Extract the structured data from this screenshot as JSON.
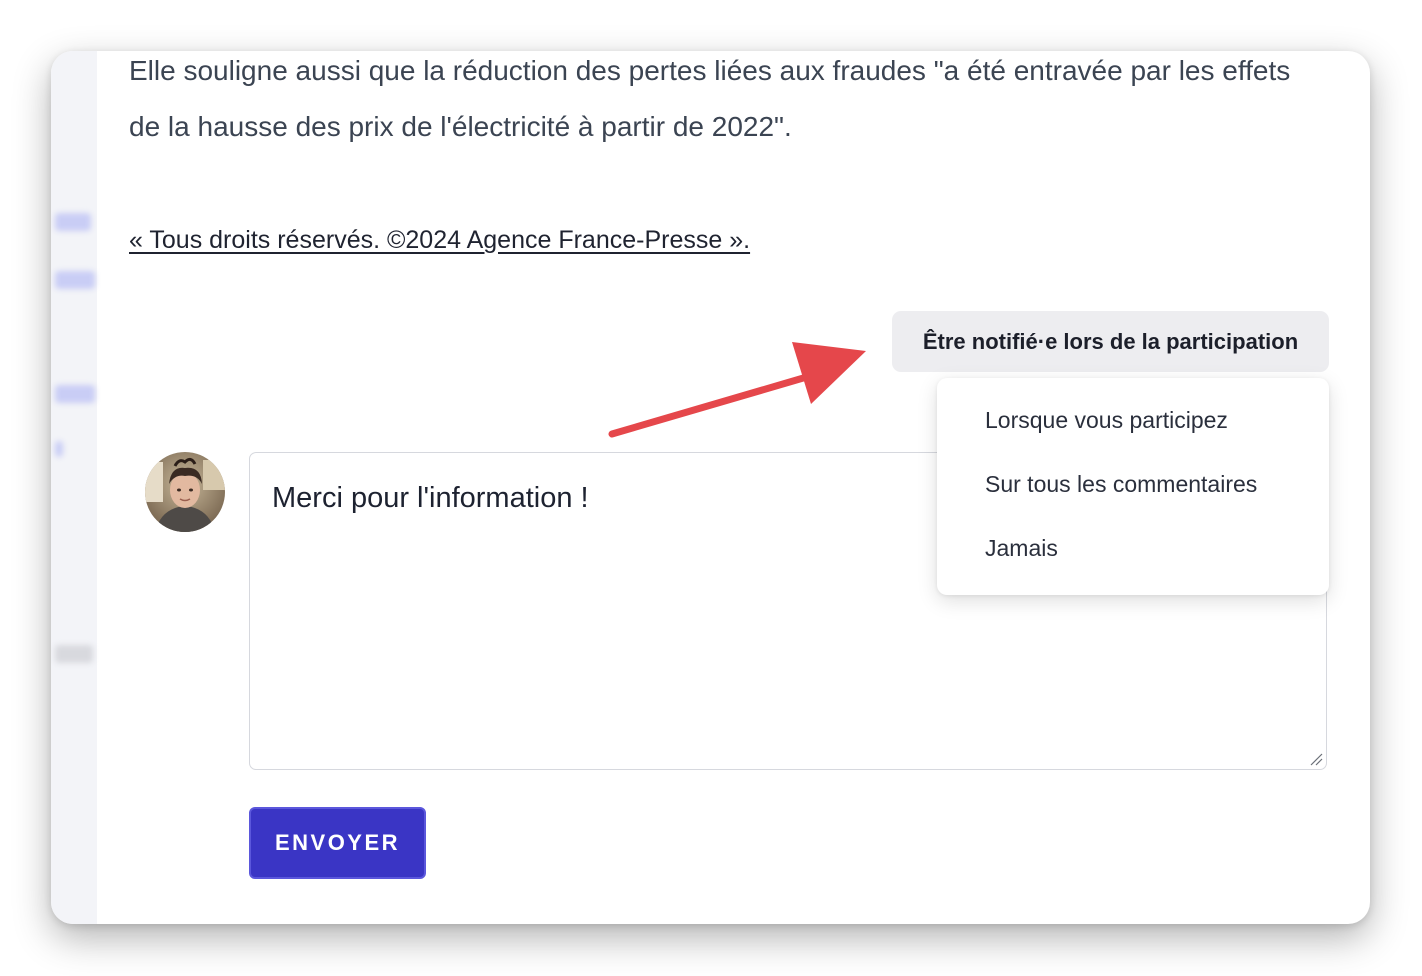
{
  "article": {
    "paragraph": "Elle souligne aussi que la réduction des pertes liées aux fraudes \"a été entravée par les effets de la hausse des prix de l'électricité à partir de 2022\".",
    "copyright": "« Tous droits réservés. ©2024 Agence France-Presse »."
  },
  "notifications": {
    "button_label": "Être notifié·e lors de la participation",
    "options": [
      {
        "label": "Lorsque vous participez"
      },
      {
        "label": "Sur tous les commentaires"
      },
      {
        "label": "Jamais"
      }
    ]
  },
  "comment": {
    "text": "Merci pour l'information !"
  },
  "send": {
    "label": "ENVOYER"
  },
  "colors": {
    "accent": "#3a35c5",
    "annotation_arrow": "#e5474b",
    "notify_button_bg": "#ededf0"
  }
}
